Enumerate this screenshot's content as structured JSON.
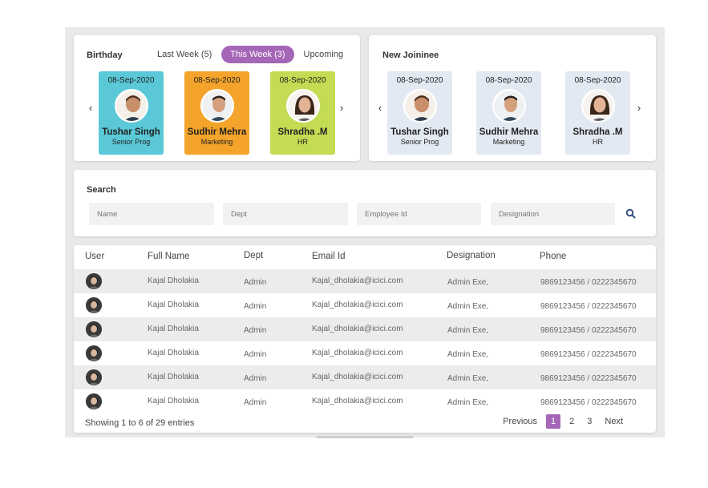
{
  "birthday": {
    "title": "Birthday",
    "tabs": [
      {
        "label": "Last Week (5)"
      },
      {
        "label": "This Week (3)"
      },
      {
        "label": "Upcoming"
      }
    ],
    "people": [
      {
        "date": "08-Sep-2020",
        "name": "Tushar Singh",
        "role": "Senior Prog",
        "color": "#5ac8d6"
      },
      {
        "date": "08-Sep-2020",
        "name": "Sudhir Mehra",
        "role": "Marketing",
        "color": "#f4a42a"
      },
      {
        "date": "08-Sep-2020",
        "name": "Shradha .M",
        "role": "HR",
        "color": "#c3dc53"
      }
    ]
  },
  "joinee": {
    "title": "New Joininee",
    "people": [
      {
        "date": "08-Sep-2020",
        "name": "Tushar Singh",
        "role": "Senior Prog"
      },
      {
        "date": "08-Sep-2020",
        "name": "Sudhir Mehra",
        "role": "Marketing"
      },
      {
        "date": "08-Sep-2020",
        "name": "Shradha .M",
        "role": "HR"
      }
    ],
    "card_color": "#e3e9f2"
  },
  "search": {
    "title": "Search",
    "placeholders": {
      "name": "Name",
      "dept": "Dept",
      "employee_id": "Employee Id",
      "designation": "Designation"
    }
  },
  "table": {
    "headers": [
      "User",
      "Full Name",
      "Dept",
      "Email Id",
      "Designation",
      "Phone"
    ],
    "rows": [
      {
        "name": "Kajal Dholakia",
        "dept": "Admin",
        "email": "Kajal_dholakia@icici.com",
        "designation": "Admin Exe,",
        "phone": "9869123456 / 0222345670"
      },
      {
        "name": "Kajal Dholakia",
        "dept": "Admin",
        "email": "Kajal_dholakia@icici.com",
        "designation": "Admin Exe,",
        "phone": "9869123456 / 0222345670"
      },
      {
        "name": "Kajal Dholakia",
        "dept": "Admin",
        "email": "Kajal_dholakia@icici.com",
        "designation": "Admin Exe,",
        "phone": "9869123456 / 0222345670"
      },
      {
        "name": "Kajal Dholakia",
        "dept": "Admin",
        "email": "Kajal_dholakia@icici.com",
        "designation": "Admin Exe,",
        "phone": "9869123456 / 0222345670"
      },
      {
        "name": "Kajal Dholakia",
        "dept": "Admin",
        "email": "Kajal_dholakia@icici.com",
        "designation": "Admin Exe,",
        "phone": "9869123456 / 0222345670"
      },
      {
        "name": "Kajal Dholakia",
        "dept": "Admin",
        "email": "Kajal_dholakia@icici.com",
        "designation": "Admin Exe,",
        "phone": "9869123456 / 0222345670"
      }
    ],
    "footer": "Showing 1 to 6 of 29 entries",
    "pager": {
      "previous": "Previous",
      "pages": [
        "1",
        "2",
        "3"
      ],
      "next": "Next"
    }
  },
  "colors": {
    "accent": "#a566b7"
  }
}
